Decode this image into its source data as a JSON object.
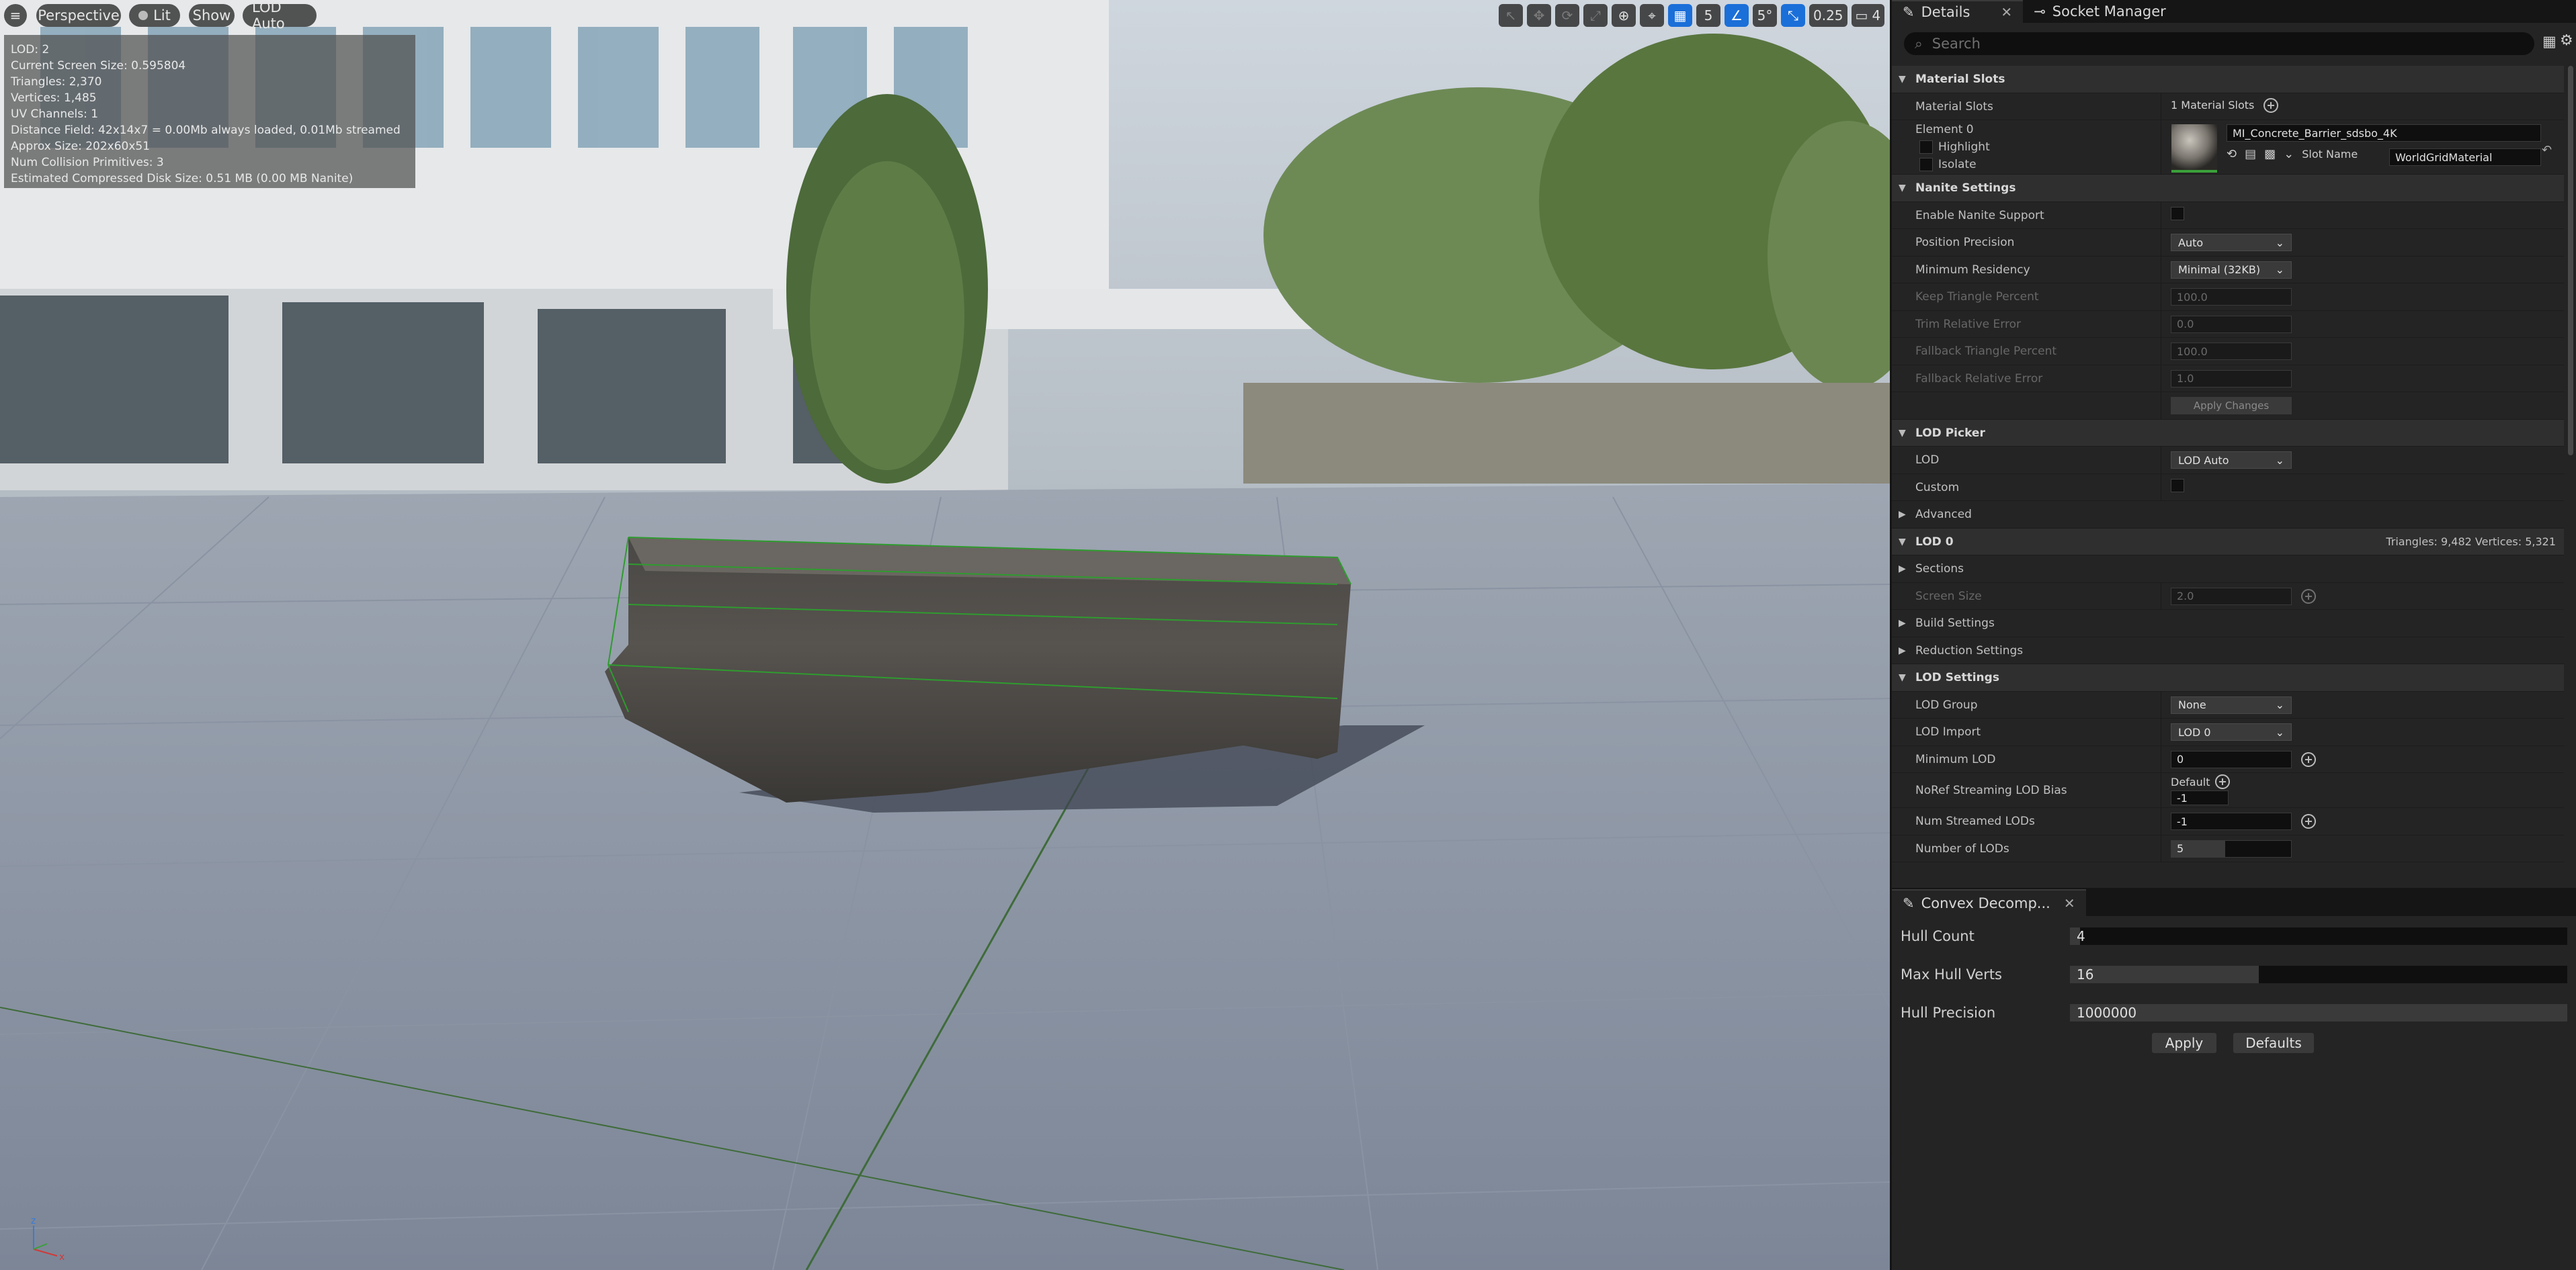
{
  "viewport": {
    "menu_icon": "hamburger-icon",
    "perspective_label": "Perspective",
    "lit_label": "Lit",
    "show_label": "Show",
    "lod_label": "LOD Auto",
    "grid_snap_value": "5",
    "angle_snap_value": "5°",
    "scale_snap_value": "0.25",
    "camera_speed_value": "4",
    "stats": [
      "LOD:  2",
      "Current Screen Size:  0.595804",
      "Triangles:  2,370",
      "Vertices:  1,485",
      "UV Channels:  1",
      "Distance Field:  42x14x7 = 0.00Mb always loaded, 0.01Mb streamed",
      "Approx Size: 202x60x51",
      "Num Collision Primitives:  3",
      "Estimated Compressed Disk Size: 0.51 MB (0.00 MB Nanite)"
    ]
  },
  "details": {
    "tab_label": "Details",
    "tab2_label": "Socket Manager",
    "search_placeholder": "Search",
    "material_slots_header": "Material Slots",
    "material_slots_label": "Material Slots",
    "material_slots_count": "1 Material Slots",
    "element_label": "Element 0",
    "highlight_label": "Highlight",
    "isolate_label": "Isolate",
    "material_name": "MI_Concrete_Barrier_sdsbo_4K",
    "slot_name_label": "Slot Name",
    "slot_name_value": "WorldGridMaterial",
    "nanite_header": "Nanite Settings",
    "enable_nanite_label": "Enable Nanite Support",
    "position_precision_label": "Position Precision",
    "position_precision_value": "Auto",
    "min_residency_label": "Minimum Residency",
    "min_residency_value": "Minimal (32KB)",
    "keep_triangle_label": "Keep Triangle Percent",
    "keep_triangle_value": "100.0",
    "trim_error_label": "Trim Relative Error",
    "trim_error_value": "0.0",
    "fallback_triangle_label": "Fallback Triangle Percent",
    "fallback_triangle_value": "100.0",
    "fallback_error_label": "Fallback Relative Error",
    "fallback_error_value": "1.0",
    "apply_changes_label": "Apply Changes",
    "lod_picker_header": "LOD Picker",
    "lod_label": "LOD",
    "lod_value": "LOD Auto",
    "custom_label": "Custom",
    "advanced_label": "Advanced",
    "lod0_header": "LOD 0",
    "lod0_stats": "Triangles: 9,482    Vertices: 5,321",
    "sections_label": "Sections",
    "screen_size_label": "Screen Size",
    "screen_size_value": "2.0",
    "build_settings_label": "Build Settings",
    "reduction_settings_label": "Reduction Settings",
    "lod_settings_header": "LOD Settings",
    "lod_group_label": "LOD Group",
    "lod_group_value": "None",
    "lod_import_label": "LOD Import",
    "lod_import_value": "LOD 0",
    "min_lod_label": "Minimum LOD",
    "min_lod_value": "0",
    "noref_label": "NoRef Streaming LOD Bias",
    "noref_default": "Default",
    "noref_value": "-1",
    "num_streamed_label": "Num Streamed LODs",
    "num_streamed_value": "-1",
    "num_lods_label": "Number of LODs",
    "num_lods_value": "5",
    "num_lods_fill": 0.45
  },
  "convex": {
    "tab_label": "Convex Decomp...",
    "hull_count_label": "Hull Count",
    "hull_count_value": "4",
    "hull_count_fill": 0.02,
    "max_verts_label": "Max Hull Verts",
    "max_verts_value": "16",
    "max_verts_fill": 0.38,
    "precision_label": "Hull Precision",
    "precision_value": "1000000",
    "precision_fill": 1.0,
    "apply_label": "Apply",
    "defaults_label": "Defaults"
  }
}
